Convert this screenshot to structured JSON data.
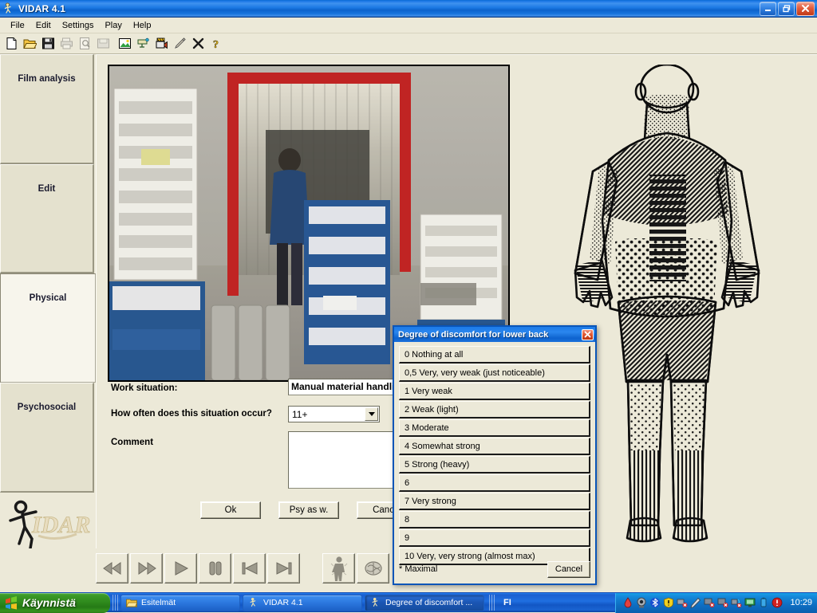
{
  "window": {
    "title": "VIDAR 4.1",
    "icon": "vidar-figure-icon",
    "minimize_label": "_",
    "restore_label": "❐",
    "close_label": "✕"
  },
  "menu": {
    "items": [
      {
        "label": "File"
      },
      {
        "label": "Edit"
      },
      {
        "label": "Settings"
      },
      {
        "label": "Play"
      },
      {
        "label": "Help"
      }
    ]
  },
  "toolbar": {
    "buttons": [
      {
        "name": "new-document-icon",
        "tip": "New"
      },
      {
        "name": "open-folder-icon",
        "tip": "Open"
      },
      {
        "name": "save-disk-icon",
        "tip": "Save"
      },
      {
        "name": "print-icon",
        "tip": "Print",
        "disabled": true
      },
      {
        "name": "print-preview-icon",
        "tip": "Print preview",
        "disabled": true
      },
      {
        "name": "export-icon",
        "tip": "Export",
        "disabled": true
      },
      {
        "name": "image-icon",
        "tip": "Image"
      },
      {
        "name": "projector-icon",
        "tip": "Projector"
      },
      {
        "name": "video-camera-icon",
        "tip": "Video"
      },
      {
        "name": "pencil-icon",
        "tip": "Edit"
      },
      {
        "name": "delete-x-icon",
        "tip": "Delete"
      },
      {
        "name": "help-question-icon",
        "tip": "Help"
      }
    ]
  },
  "sidebar": {
    "tabs": [
      {
        "label": "Film analysis",
        "active": false
      },
      {
        "label": "Edit",
        "active": false
      },
      {
        "label": "Physical",
        "active": true
      },
      {
        "label": "Psychosocial",
        "active": false
      }
    ],
    "logo_text": "VIDAR"
  },
  "form": {
    "work_situation_label": "Work situation:",
    "work_situation_value": "Manual material handling",
    "frequency_label": "How often does this situation occur?",
    "frequency_value": "11+",
    "comment_label": "Comment",
    "comment_value": "",
    "buttons": [
      {
        "label": "Ok",
        "name": "ok-button"
      },
      {
        "label": "Psy as w.",
        "name": "psy-as-w-button"
      },
      {
        "label": "Cancel",
        "name": "cancel-button"
      }
    ]
  },
  "media_controls": [
    {
      "name": "rewind-button",
      "glyph": "rewind"
    },
    {
      "name": "fast-forward-button",
      "glyph": "fast-forward"
    },
    {
      "name": "play-button",
      "glyph": "play"
    },
    {
      "name": "pause-button",
      "glyph": "pause"
    },
    {
      "name": "previous-frame-button",
      "glyph": "prev"
    },
    {
      "name": "next-frame-button",
      "glyph": "next"
    },
    {
      "name": "body-map-button",
      "glyph": "body"
    },
    {
      "name": "brain-map-button",
      "glyph": "brain"
    }
  ],
  "dialog": {
    "title": "Degree of discomfort for lower back",
    "close_label": "✕",
    "options": [
      "0 Nothing at all",
      "0,5 Very, very weak (just noticeable)",
      "1 Very weak",
      "2 Weak (light)",
      "3 Moderate",
      "4 Somewhat strong",
      "5 Strong (heavy)",
      "6",
      "7 Very strong",
      "8",
      "9",
      "10 Very, very strong (almost max)"
    ],
    "footer_label": "* Maximal",
    "cancel_label": "Cancel"
  },
  "body_diagram": {
    "view": "back",
    "regions": [
      {
        "name": "neck",
        "pattern": "fine-dots"
      },
      {
        "name": "upper-back-shoulders",
        "pattern": "diagonal-hatch"
      },
      {
        "name": "spine",
        "pattern": "horizontal-bars"
      },
      {
        "name": "forearms",
        "pattern": "dense-dots"
      },
      {
        "name": "hands",
        "pattern": "horizontal-lines"
      },
      {
        "name": "lower-back-buttocks",
        "pattern": "coarse-dots"
      },
      {
        "name": "thighs",
        "pattern": "diagonal-hatch"
      },
      {
        "name": "calves",
        "pattern": "sparse-dots"
      },
      {
        "name": "ankles-feet",
        "pattern": "vertical-lines"
      }
    ]
  },
  "taskbar": {
    "start_label": "Käynnistä",
    "tasks": [
      {
        "label": "Esitelmät",
        "icon": "folder-icon",
        "active": false
      },
      {
        "label": "VIDAR 4.1",
        "icon": "vidar-figure-icon",
        "active": false
      },
      {
        "label": "Degree of discomfort ...",
        "icon": "vidar-figure-icon",
        "active": true
      }
    ],
    "language": "FI",
    "clock": "10:29",
    "tray_icons": [
      "drop-icon",
      "webcam-icon",
      "bluetooth-icon",
      "shield-warning-icon",
      "network-error-icon",
      "pen-icon",
      "monitor-error-icon",
      "monitor-error2-icon",
      "wireless-error-icon",
      "display-icon",
      "battery-icon",
      "security-alert-icon"
    ]
  },
  "colors": {
    "xp_face": "#ece9d8",
    "xp_title_blue": "#1f7ae8",
    "taskbar_blue": "#1f6fe0",
    "start_green": "#2f8a1d",
    "close_red": "#e25c3c"
  }
}
